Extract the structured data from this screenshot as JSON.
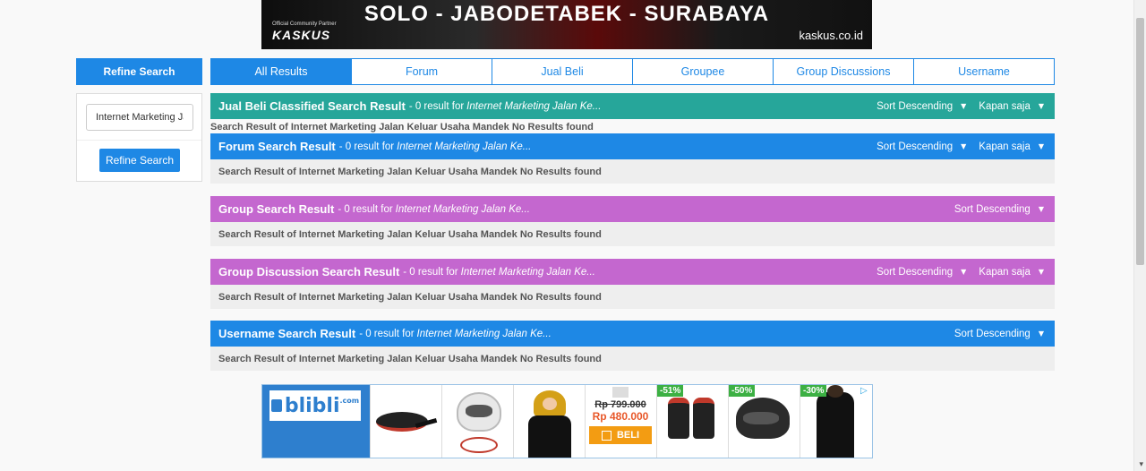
{
  "top_banner": {
    "headline": "SOLO - JABODETABEK - SURABAYA",
    "partner_note": "Official Community Partner",
    "brand": "KASKUS",
    "site": "kaskus.co.id"
  },
  "refine": {
    "header": "Refine Search",
    "query_value": "Internet Marketing Jalan Keluar Usaha Mandek",
    "button_label": "Refine Search"
  },
  "tabs": [
    {
      "label": "All Results",
      "active": true
    },
    {
      "label": "Forum",
      "active": false
    },
    {
      "label": "Jual Beli",
      "active": false
    },
    {
      "label": "Groupee",
      "active": false
    },
    {
      "label": "Group Discussions",
      "active": false
    },
    {
      "label": "Username",
      "active": false
    }
  ],
  "sections": [
    {
      "title": "Jual Beli Classified Search Result",
      "count": "- 0 result for",
      "query": "Internet Marketing Jalan Ke...",
      "sort": "Sort Descending",
      "time": "Kapan saja",
      "color": "#26a69a",
      "message": "Search Result of Internet Marketing Jalan Keluar Usaha Mandek No Results found"
    },
    {
      "title": "Forum Search Result",
      "count": "- 0 result for",
      "query": "Internet Marketing Jalan Ke...",
      "sort": "Sort Descending",
      "time": "Kapan saja",
      "color": "#1e88e5",
      "message": "Search Result of Internet Marketing Jalan Keluar Usaha Mandek No Results found"
    },
    {
      "title": "Group Search Result",
      "count": "- 0 result for",
      "query": "Internet Marketing Jalan Ke...",
      "sort": "Sort Descending",
      "color": "#c467cf",
      "message": "Search Result of Internet Marketing Jalan Keluar Usaha Mandek No Results found"
    },
    {
      "title": "Group Discussion Search Result",
      "count": "- 0 result for",
      "query": "Internet Marketing Jalan Ke...",
      "sort": "Sort Descending",
      "time": "Kapan saja",
      "color": "#c467cf",
      "message": "Search Result of Internet Marketing Jalan Keluar Usaha Mandek No Results found"
    },
    {
      "title": "Username Search Result",
      "count": "- 0 result for",
      "query": "Internet Marketing Jalan Ke...",
      "sort": "Sort Descending",
      "color": "#1e88e5",
      "message": "Search Result of Internet Marketing Jalan Keluar Usaha Mandek No Results found"
    }
  ],
  "bottom_ad": {
    "logo_text": "blibli",
    "logo_sup": ".com",
    "old_price": "Rp 799.000",
    "new_price": "Rp 480.000",
    "buy_label": "BELI",
    "badges": [
      "-51%",
      "-50%",
      "-30%"
    ]
  }
}
